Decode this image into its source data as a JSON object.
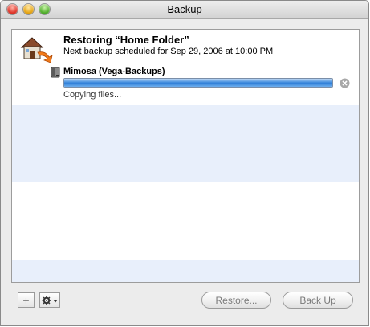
{
  "window": {
    "title": "Backup"
  },
  "backup_item": {
    "title": "Restoring “Home Folder”",
    "schedule": "Next backup scheduled for Sep 29, 2006 at 10:00 PM",
    "destination": "Mimosa (Vega-Backups)",
    "status": "Copying files...",
    "progress": 1.0,
    "icon": "home-folder-icon",
    "destination_icon": "disk-icon"
  },
  "toolbar": {
    "add_label": "+",
    "restore_label": "Restore...",
    "backup_label": "Back Up"
  },
  "colors": {
    "stripe": "#e8effb",
    "progress": "#2f7fd8",
    "disabled_text": "#7a7a7a"
  }
}
